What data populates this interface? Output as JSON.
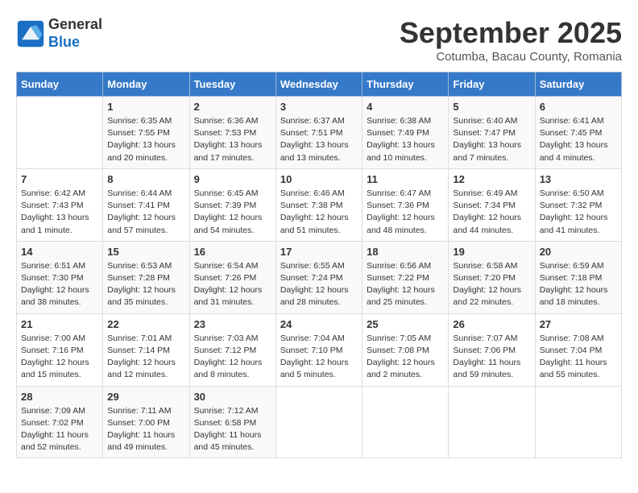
{
  "header": {
    "logo_line1": "General",
    "logo_line2": "Blue",
    "month_title": "September 2025",
    "subtitle": "Cotumba, Bacau County, Romania"
  },
  "weekdays": [
    "Sunday",
    "Monday",
    "Tuesday",
    "Wednesday",
    "Thursday",
    "Friday",
    "Saturday"
  ],
  "weeks": [
    [
      {
        "day": "",
        "info": ""
      },
      {
        "day": "1",
        "info": "Sunrise: 6:35 AM\nSunset: 7:55 PM\nDaylight: 13 hours and 20 minutes."
      },
      {
        "day": "2",
        "info": "Sunrise: 6:36 AM\nSunset: 7:53 PM\nDaylight: 13 hours and 17 minutes."
      },
      {
        "day": "3",
        "info": "Sunrise: 6:37 AM\nSunset: 7:51 PM\nDaylight: 13 hours and 13 minutes."
      },
      {
        "day": "4",
        "info": "Sunrise: 6:38 AM\nSunset: 7:49 PM\nDaylight: 13 hours and 10 minutes."
      },
      {
        "day": "5",
        "info": "Sunrise: 6:40 AM\nSunset: 7:47 PM\nDaylight: 13 hours and 7 minutes."
      },
      {
        "day": "6",
        "info": "Sunrise: 6:41 AM\nSunset: 7:45 PM\nDaylight: 13 hours and 4 minutes."
      }
    ],
    [
      {
        "day": "7",
        "info": "Sunrise: 6:42 AM\nSunset: 7:43 PM\nDaylight: 13 hours and 1 minute."
      },
      {
        "day": "8",
        "info": "Sunrise: 6:44 AM\nSunset: 7:41 PM\nDaylight: 12 hours and 57 minutes."
      },
      {
        "day": "9",
        "info": "Sunrise: 6:45 AM\nSunset: 7:39 PM\nDaylight: 12 hours and 54 minutes."
      },
      {
        "day": "10",
        "info": "Sunrise: 6:46 AM\nSunset: 7:38 PM\nDaylight: 12 hours and 51 minutes."
      },
      {
        "day": "11",
        "info": "Sunrise: 6:47 AM\nSunset: 7:36 PM\nDaylight: 12 hours and 48 minutes."
      },
      {
        "day": "12",
        "info": "Sunrise: 6:49 AM\nSunset: 7:34 PM\nDaylight: 12 hours and 44 minutes."
      },
      {
        "day": "13",
        "info": "Sunrise: 6:50 AM\nSunset: 7:32 PM\nDaylight: 12 hours and 41 minutes."
      }
    ],
    [
      {
        "day": "14",
        "info": "Sunrise: 6:51 AM\nSunset: 7:30 PM\nDaylight: 12 hours and 38 minutes."
      },
      {
        "day": "15",
        "info": "Sunrise: 6:53 AM\nSunset: 7:28 PM\nDaylight: 12 hours and 35 minutes."
      },
      {
        "day": "16",
        "info": "Sunrise: 6:54 AM\nSunset: 7:26 PM\nDaylight: 12 hours and 31 minutes."
      },
      {
        "day": "17",
        "info": "Sunrise: 6:55 AM\nSunset: 7:24 PM\nDaylight: 12 hours and 28 minutes."
      },
      {
        "day": "18",
        "info": "Sunrise: 6:56 AM\nSunset: 7:22 PM\nDaylight: 12 hours and 25 minutes."
      },
      {
        "day": "19",
        "info": "Sunrise: 6:58 AM\nSunset: 7:20 PM\nDaylight: 12 hours and 22 minutes."
      },
      {
        "day": "20",
        "info": "Sunrise: 6:59 AM\nSunset: 7:18 PM\nDaylight: 12 hours and 18 minutes."
      }
    ],
    [
      {
        "day": "21",
        "info": "Sunrise: 7:00 AM\nSunset: 7:16 PM\nDaylight: 12 hours and 15 minutes."
      },
      {
        "day": "22",
        "info": "Sunrise: 7:01 AM\nSunset: 7:14 PM\nDaylight: 12 hours and 12 minutes."
      },
      {
        "day": "23",
        "info": "Sunrise: 7:03 AM\nSunset: 7:12 PM\nDaylight: 12 hours and 8 minutes."
      },
      {
        "day": "24",
        "info": "Sunrise: 7:04 AM\nSunset: 7:10 PM\nDaylight: 12 hours and 5 minutes."
      },
      {
        "day": "25",
        "info": "Sunrise: 7:05 AM\nSunset: 7:08 PM\nDaylight: 12 hours and 2 minutes."
      },
      {
        "day": "26",
        "info": "Sunrise: 7:07 AM\nSunset: 7:06 PM\nDaylight: 11 hours and 59 minutes."
      },
      {
        "day": "27",
        "info": "Sunrise: 7:08 AM\nSunset: 7:04 PM\nDaylight: 11 hours and 55 minutes."
      }
    ],
    [
      {
        "day": "28",
        "info": "Sunrise: 7:09 AM\nSunset: 7:02 PM\nDaylight: 11 hours and 52 minutes."
      },
      {
        "day": "29",
        "info": "Sunrise: 7:11 AM\nSunset: 7:00 PM\nDaylight: 11 hours and 49 minutes."
      },
      {
        "day": "30",
        "info": "Sunrise: 7:12 AM\nSunset: 6:58 PM\nDaylight: 11 hours and 45 minutes."
      },
      {
        "day": "",
        "info": ""
      },
      {
        "day": "",
        "info": ""
      },
      {
        "day": "",
        "info": ""
      },
      {
        "day": "",
        "info": ""
      }
    ]
  ]
}
